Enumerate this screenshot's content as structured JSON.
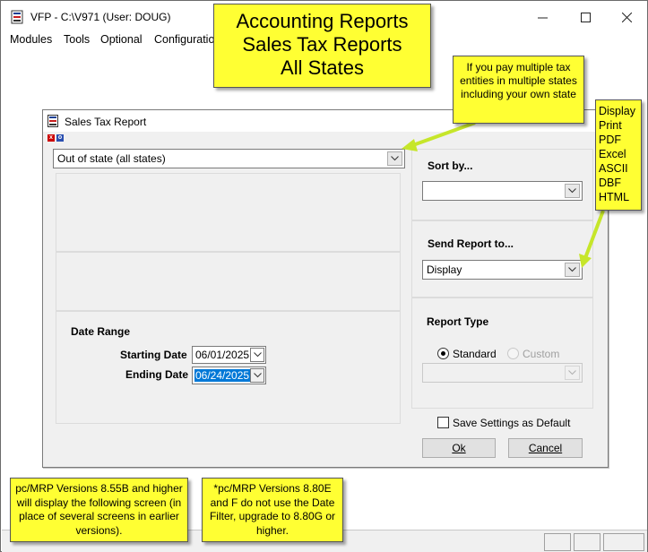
{
  "window": {
    "title": "VFP - C:\\V971  (User: DOUG)"
  },
  "menu": [
    "Modules",
    "Tools",
    "Optional",
    "Configuratio"
  ],
  "dialog": {
    "title": "Sales Tax Report",
    "state_combo_value": "Out of state (all states)",
    "date_range_label": "Date Range",
    "starting_date_label": "Starting Date",
    "starting_date_value": "06/01/2025",
    "ending_date_label": "Ending Date",
    "ending_date_value": "06/24/2025",
    "sort_by_label": "Sort by...",
    "sort_by_value": "",
    "send_report_label": "Send Report to...",
    "send_report_value": "Display",
    "report_type_label": "Report Type",
    "standard_label": "Standard",
    "custom_label": "Custom",
    "save_settings_label": "Save Settings as Default",
    "ok_label": "Ok",
    "cancel_label": "Cancel"
  },
  "callouts": {
    "main": [
      "Accounting Reports",
      "Sales Tax Reports",
      "All States"
    ],
    "tax": "If you pay multiple tax entities in multiple states including your own state",
    "send_options": [
      "Display",
      "Print",
      "PDF",
      "Excel",
      "ASCII",
      "DBF",
      "HTML"
    ],
    "version_1": "pc/MRP Versions 8.55B and higher will display the following screen (in place of several screens in earlier versions).",
    "version_2": "*pc/MRP Versions 8.80E and F do not use the Date Filter, upgrade to 8.80G or higher."
  },
  "colors": {
    "callout": "#ffff33",
    "arrow": "#c6e62a",
    "selection": "#0078d7",
    "dialog_bg": "#f0f0f0"
  }
}
